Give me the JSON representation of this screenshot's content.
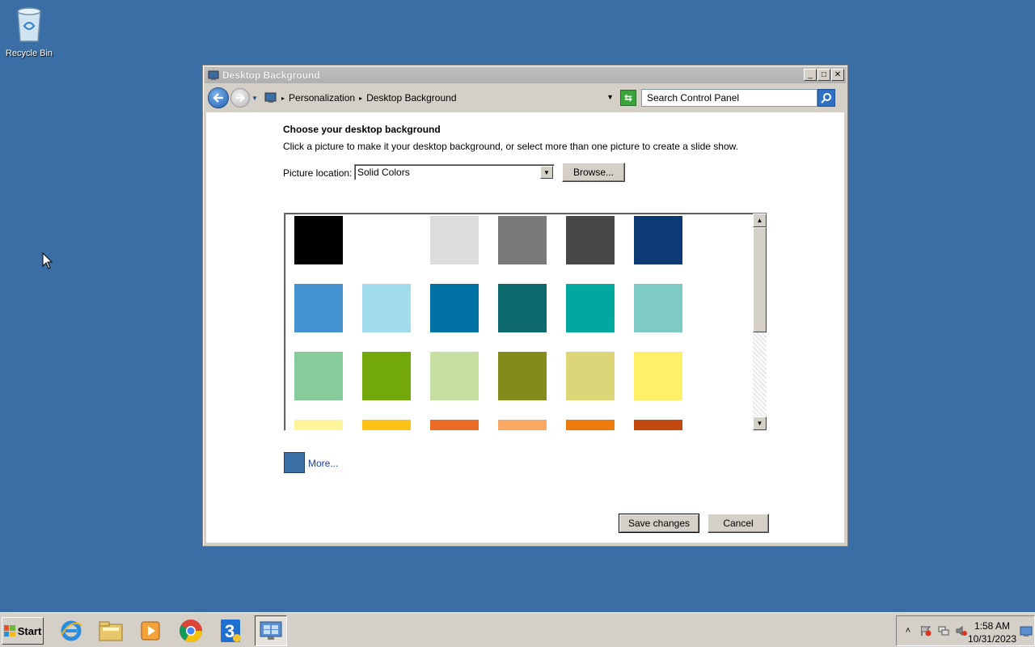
{
  "desktop": {
    "recycle_bin_label": "Recycle Bin",
    "background_color": "#3a6ea5"
  },
  "window": {
    "title": "Desktop Background",
    "controls": [
      "minimize",
      "maximize",
      "close"
    ]
  },
  "address_bar": {
    "breadcrumbs": [
      "Personalization",
      "Desktop Background"
    ],
    "search_placeholder": "Search Control Panel"
  },
  "content": {
    "heading": "Choose your desktop background",
    "description": "Click a picture to make it your desktop background, or select more than one picture to create a slide show.",
    "picture_location_label": "Picture location:",
    "picture_location_value": "Solid Colors",
    "browse_label": "Browse...",
    "more_label": "More...",
    "more_swatch_color": "#3a6ea5",
    "save_label": "Save changes",
    "cancel_label": "Cancel"
  },
  "swatches": [
    "#000000",
    "#ffffff",
    "#dcdcdc",
    "#7a7a7a",
    "#484848",
    "#0c3a75",
    "#4493d0",
    "#a2dbec",
    "#0072a6",
    "#0e6b6d",
    "#00a89f",
    "#7ecbc4",
    "#86cb9a",
    "#72a80c",
    "#c6e0a2",
    "#858a1c",
    "#dcd678",
    "#fef167",
    "#fef49a",
    "#fec217",
    "#eb6a24",
    "#faa965",
    "#ed7a0c",
    "#c24a0e"
  ],
  "taskbar": {
    "start_label": "Start",
    "apps": [
      "internet-explorer",
      "file-explorer",
      "media-player",
      "chrome",
      "app-3",
      "control-panel"
    ],
    "clock_time": "1:58 AM",
    "clock_date": "10/31/2023"
  }
}
